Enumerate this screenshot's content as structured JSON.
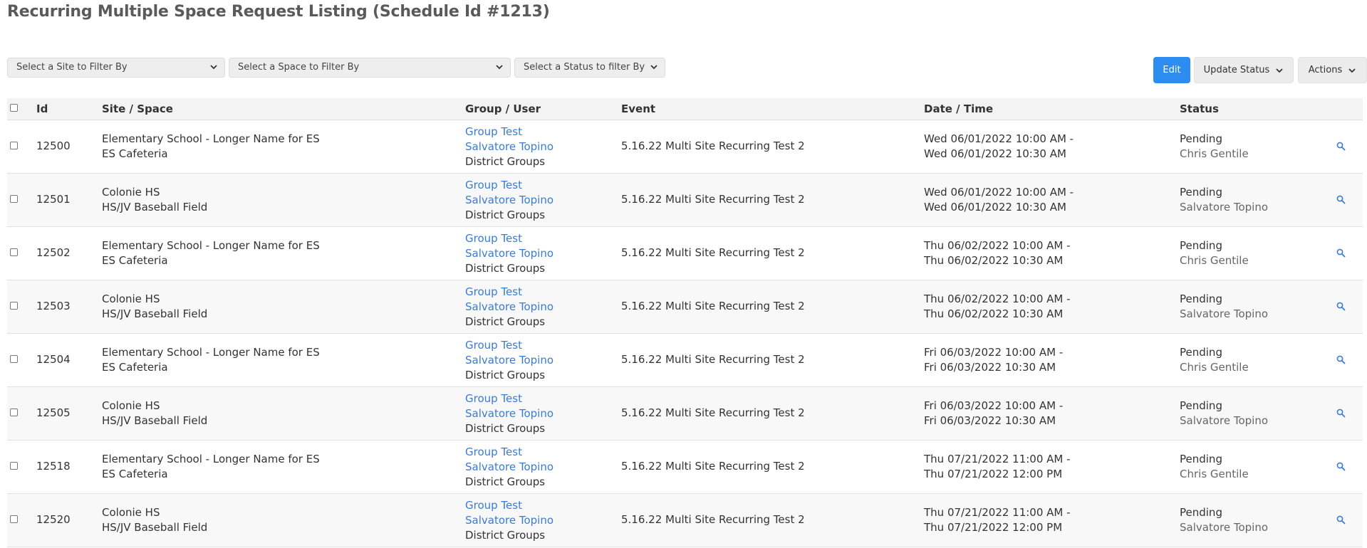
{
  "page": {
    "title": "Recurring Multiple Space Request Listing (Schedule Id #1213)"
  },
  "filters": {
    "site": "Select a Site to Filter By",
    "space": "Select a Space to Filter By",
    "status": "Select a Status to filter By"
  },
  "toolbar": {
    "edit": "Edit",
    "update_status": "Update Status",
    "actions": "Actions"
  },
  "colors": {
    "accent": "#2d8cf0",
    "link": "#3a7bd5"
  },
  "table": {
    "headers": {
      "id": "Id",
      "site_space": "Site / Space",
      "group_user": "Group / User",
      "event": "Event",
      "date_time": "Date / Time",
      "status": "Status"
    },
    "rows": [
      {
        "id": "12500",
        "site": "Elementary School - Longer Name for ES",
        "space": "ES Cafeteria",
        "group": "Group Test",
        "user": "Salvatore Topino",
        "group_type": "District Groups",
        "event": "5.16.22 Multi Site Recurring Test 2",
        "start": "Wed 06/01/2022 10:00 AM -",
        "end": "Wed 06/01/2022 10:30 AM",
        "status": "Pending",
        "approver": "Chris Gentile"
      },
      {
        "id": "12501",
        "site": "Colonie HS",
        "space": "HS/JV Baseball Field",
        "group": "Group Test",
        "user": "Salvatore Topino",
        "group_type": "District Groups",
        "event": "5.16.22 Multi Site Recurring Test 2",
        "start": "Wed 06/01/2022 10:00 AM -",
        "end": "Wed 06/01/2022 10:30 AM",
        "status": "Pending",
        "approver": "Salvatore Topino"
      },
      {
        "id": "12502",
        "site": "Elementary School - Longer Name for ES",
        "space": "ES Cafeteria",
        "group": "Group Test",
        "user": "Salvatore Topino",
        "group_type": "District Groups",
        "event": "5.16.22 Multi Site Recurring Test 2",
        "start": "Thu 06/02/2022 10:00 AM -",
        "end": "Thu 06/02/2022 10:30 AM",
        "status": "Pending",
        "approver": "Chris Gentile"
      },
      {
        "id": "12503",
        "site": "Colonie HS",
        "space": "HS/JV Baseball Field",
        "group": "Group Test",
        "user": "Salvatore Topino",
        "group_type": "District Groups",
        "event": "5.16.22 Multi Site Recurring Test 2",
        "start": "Thu 06/02/2022 10:00 AM -",
        "end": "Thu 06/02/2022 10:30 AM",
        "status": "Pending",
        "approver": "Salvatore Topino"
      },
      {
        "id": "12504",
        "site": "Elementary School - Longer Name for ES",
        "space": "ES Cafeteria",
        "group": "Group Test",
        "user": "Salvatore Topino",
        "group_type": "District Groups",
        "event": "5.16.22 Multi Site Recurring Test 2",
        "start": "Fri 06/03/2022 10:00 AM -",
        "end": "Fri 06/03/2022 10:30 AM",
        "status": "Pending",
        "approver": "Chris Gentile"
      },
      {
        "id": "12505",
        "site": "Colonie HS",
        "space": "HS/JV Baseball Field",
        "group": "Group Test",
        "user": "Salvatore Topino",
        "group_type": "District Groups",
        "event": "5.16.22 Multi Site Recurring Test 2",
        "start": "Fri 06/03/2022 10:00 AM -",
        "end": "Fri 06/03/2022 10:30 AM",
        "status": "Pending",
        "approver": "Salvatore Topino"
      },
      {
        "id": "12518",
        "site": "Elementary School - Longer Name for ES",
        "space": "ES Cafeteria",
        "group": "Group Test",
        "user": "Salvatore Topino",
        "group_type": "District Groups",
        "event": "5.16.22 Multi Site Recurring Test 2",
        "start": "Thu 07/21/2022 11:00 AM -",
        "end": "Thu 07/21/2022 12:00 PM",
        "status": "Pending",
        "approver": "Chris Gentile"
      },
      {
        "id": "12520",
        "site": "Colonie HS",
        "space": "HS/JV Baseball Field",
        "group": "Group Test",
        "user": "Salvatore Topino",
        "group_type": "District Groups",
        "event": "5.16.22 Multi Site Recurring Test 2",
        "start": "Thu 07/21/2022 11:00 AM -",
        "end": "Thu 07/21/2022 12:00 PM",
        "status": "Pending",
        "approver": "Salvatore Topino"
      }
    ]
  }
}
